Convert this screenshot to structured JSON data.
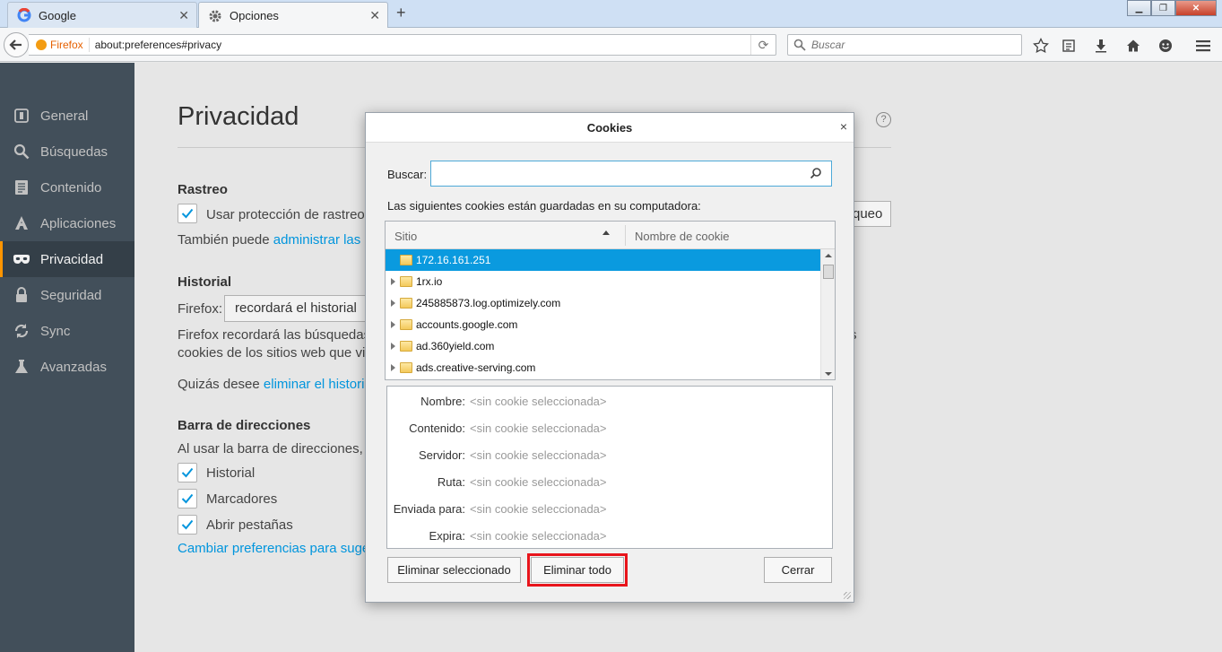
{
  "browser": {
    "tabs": [
      {
        "label": "Google",
        "icon": "google-icon"
      },
      {
        "label": "Opciones",
        "icon": "gear-icon"
      }
    ],
    "new_tab_symbol": "+",
    "url_identity": "Firefox",
    "url": "about:preferences#privacy",
    "search_placeholder": "Buscar"
  },
  "sidebar": {
    "items": [
      {
        "label": "General",
        "icon": "general-icon"
      },
      {
        "label": "Búsquedas",
        "icon": "search-icon"
      },
      {
        "label": "Contenido",
        "icon": "content-icon"
      },
      {
        "label": "Aplicaciones",
        "icon": "applications-icon"
      },
      {
        "label": "Privacidad",
        "icon": "privacy-mask-icon",
        "active": true
      },
      {
        "label": "Seguridad",
        "icon": "security-icon"
      },
      {
        "label": "Sync",
        "icon": "sync-icon"
      },
      {
        "label": "Avanzadas",
        "icon": "advanced-icon"
      }
    ]
  },
  "main": {
    "title": "Privacidad",
    "help": "?",
    "tracking_heading": "Rastreo",
    "tracking_checkbox": "Usar protección de rastreo",
    "tracking_button_partial": "queo",
    "tracking_text_prefix": "También puede",
    "tracking_link": "administrar las",
    "history_heading": "Historial",
    "history_firefox_label": "Firefox:",
    "history_select": "recordará el historial",
    "history_text_line1": "Firefox recordará las búsquedas",
    "history_text_line1_end": "s",
    "history_text_line2": "cookies de los sitios web que vis",
    "history_clear_prefix": "Quizás desee",
    "history_clear_link": "eliminar el historia",
    "addressbar_heading": "Barra de direcciones",
    "addressbar_text": "Al usar la barra de direcciones, s",
    "addressbar_options": [
      "Historial",
      "Marcadores",
      "Abrir pestañas"
    ],
    "addressbar_link": "Cambiar preferencias para suge"
  },
  "dialog": {
    "title": "Cookies",
    "close": "×",
    "search_label": "Buscar:",
    "search_value": "",
    "info": "Las siguientes cookies están guardadas en su computadora:",
    "columns": {
      "site": "Sitio",
      "cookie_name": "Nombre de cookie"
    },
    "sites": [
      {
        "name": "172.16.161.251",
        "selected": true,
        "expandable": false
      },
      {
        "name": "1rx.io",
        "selected": false,
        "expandable": true
      },
      {
        "name": "245885873.log.optimizely.com",
        "selected": false,
        "expandable": true
      },
      {
        "name": "accounts.google.com",
        "selected": false,
        "expandable": true
      },
      {
        "name": "ad.360yield.com",
        "selected": false,
        "expandable": true
      },
      {
        "name": "ads.creative-serving.com",
        "selected": false,
        "expandable": true
      }
    ],
    "details": [
      {
        "label": "Nombre:",
        "value": "<sin cookie seleccionada>"
      },
      {
        "label": "Contenido:",
        "value": "<sin cookie seleccionada>"
      },
      {
        "label": "Servidor:",
        "value": "<sin cookie seleccionada>"
      },
      {
        "label": "Ruta:",
        "value": "<sin cookie seleccionada>"
      },
      {
        "label": "Enviada para:",
        "value": "<sin cookie seleccionada>"
      },
      {
        "label": "Expira:",
        "value": "<sin cookie seleccionada>"
      }
    ],
    "buttons": {
      "remove_selected": "Eliminar seleccionado",
      "remove_all": "Eliminar todo",
      "close": "Cerrar"
    },
    "highlight_color": "#e8141b"
  },
  "colors": {
    "accent": "#0a9adf",
    "sidebar_bg": "#424f5a",
    "sidebar_active_marker": "#ff9500",
    "link": "#0095dd"
  }
}
